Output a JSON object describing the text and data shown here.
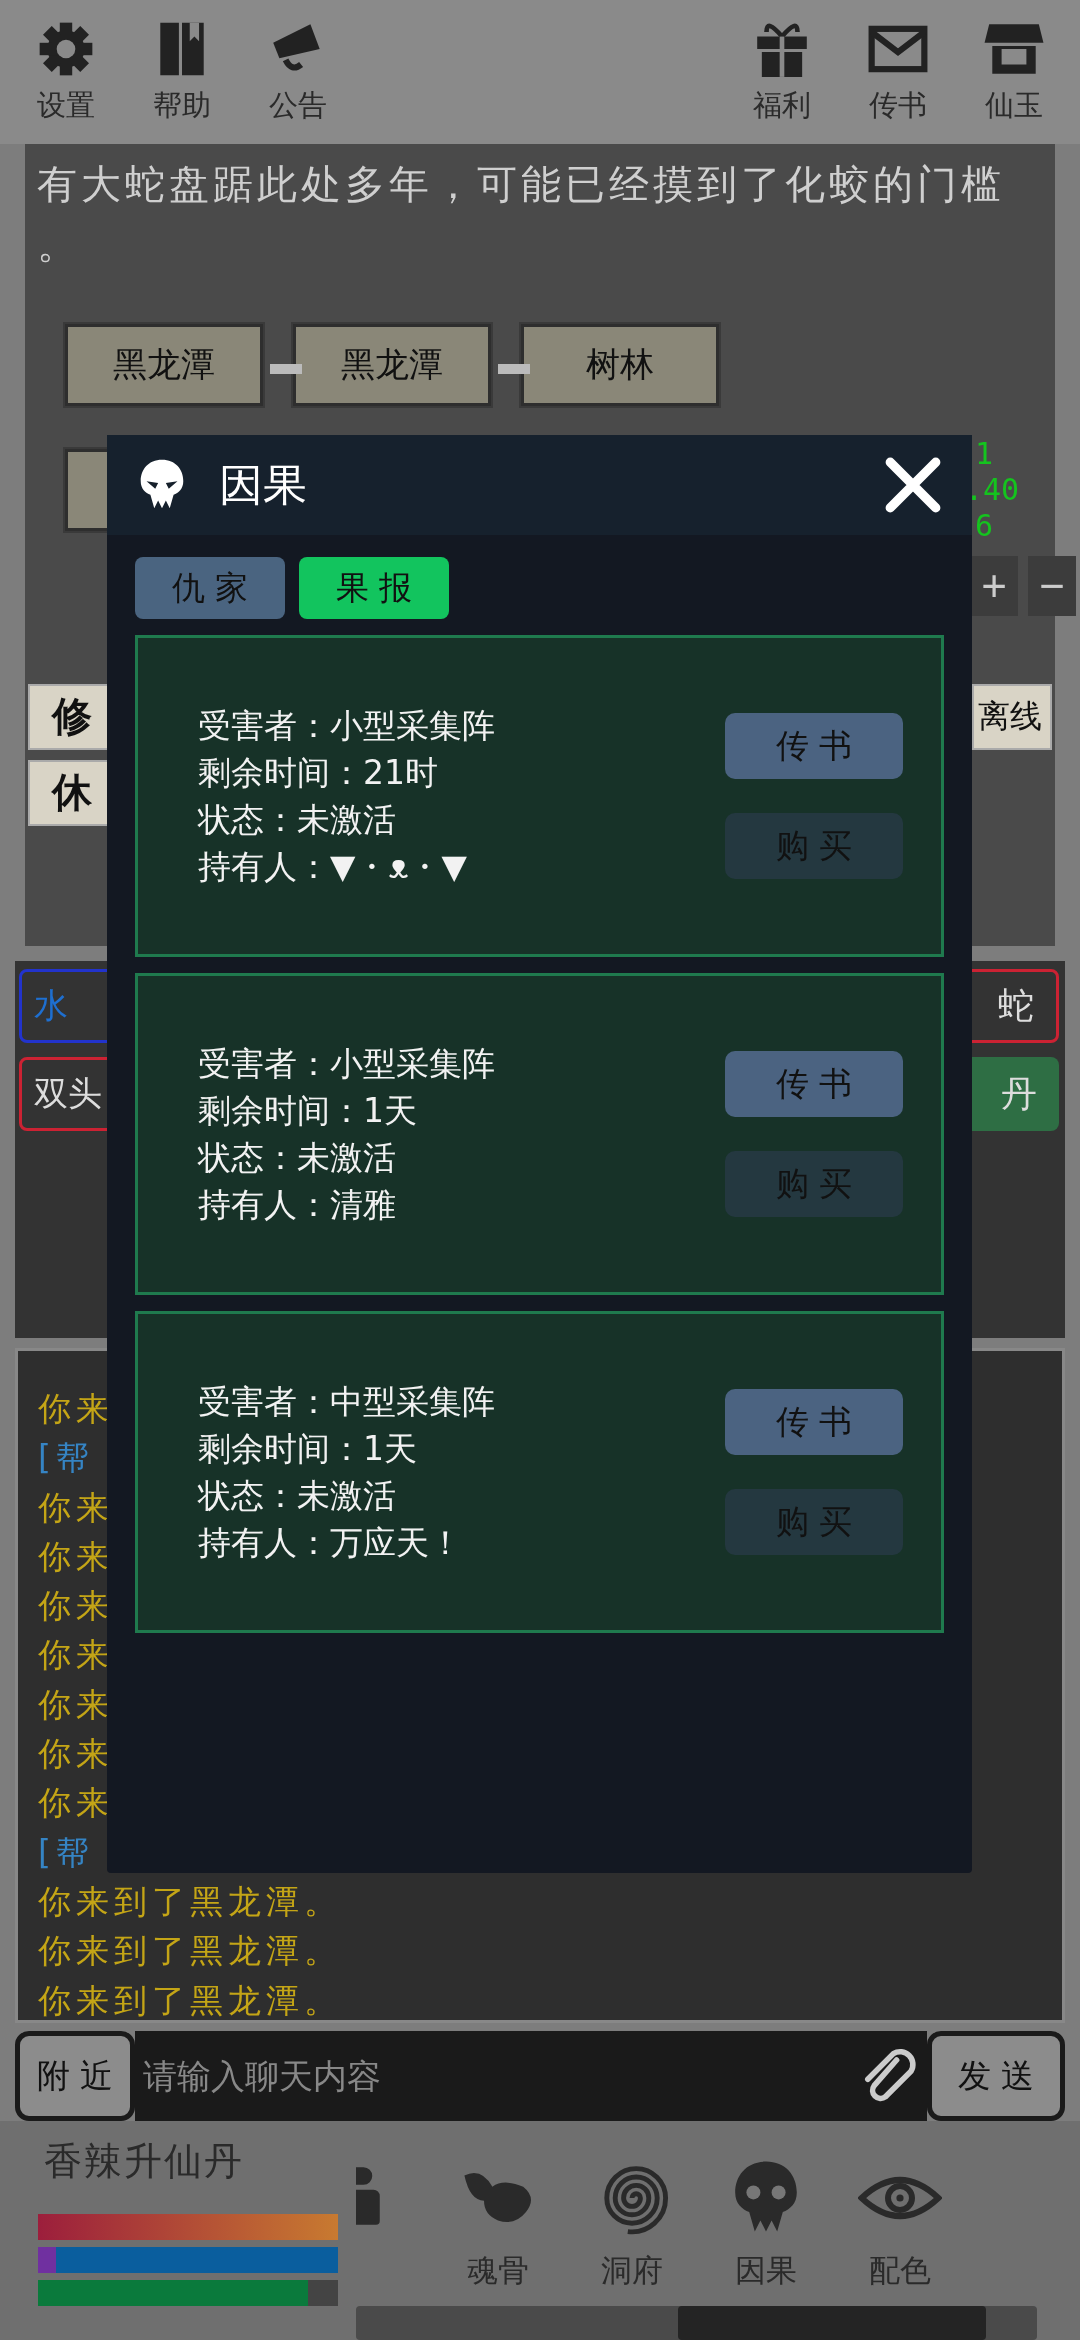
{
  "top_bar": {
    "left": [
      {
        "label": "设置",
        "kind": "gear"
      },
      {
        "label": "帮助",
        "kind": "book"
      },
      {
        "label": "公告",
        "kind": "megaphone"
      }
    ],
    "right": [
      {
        "label": "福利",
        "kind": "gift"
      },
      {
        "label": "传书",
        "kind": "mail"
      },
      {
        "label": "仙玉",
        "kind": "shop"
      }
    ]
  },
  "location": {
    "description": "有大蛇盘踞此处多年，可能已经摸到了化蛟的门槛。",
    "map_nodes": [
      {
        "label": "黑龙潭"
      },
      {
        "label": "黑龙潭"
      },
      {
        "label": "树林"
      }
    ],
    "coordinate_fragments": [
      "1",
      ".40",
      "6"
    ],
    "zoom_controls": [
      "+",
      "−"
    ],
    "actions_left": [
      "修",
      "休"
    ],
    "actions_right": [
      "离线"
    ]
  },
  "monsters": [
    {
      "left": {
        "label": "水",
        "color": "#2233cc"
      },
      "right": {
        "label": "蛇",
        "kind": "outline",
        "color": "#cc2233"
      }
    },
    {
      "left": {
        "label": "双头",
        "color": "#cc2233"
      },
      "right": {
        "label": "丹",
        "kind": "filled",
        "color": "#2e6e44"
      }
    }
  ],
  "log": [
    {
      "text": "你来",
      "kind": "move"
    },
    {
      "text": "[帮",
      "kind": "help"
    },
    {
      "text": "你来",
      "kind": "move"
    },
    {
      "text": "你来",
      "kind": "move"
    },
    {
      "text": "你来",
      "kind": "move"
    },
    {
      "text": "你来",
      "kind": "move"
    },
    {
      "text": "你来",
      "kind": "move"
    },
    {
      "text": "你来",
      "kind": "move"
    },
    {
      "text": "你来",
      "kind": "move"
    },
    {
      "text": "[帮",
      "kind": "help"
    },
    {
      "text": "你来到了黑龙潭。",
      "kind": "move"
    },
    {
      "text": "你来到了黑龙潭。",
      "kind": "move"
    },
    {
      "text": "你来到了黑龙潭。",
      "kind": "move"
    }
  ],
  "dialog": {
    "title": "因果",
    "tabs": [
      {
        "label": "仇 家",
        "selected": false
      },
      {
        "label": "果 报",
        "selected": true
      }
    ],
    "cards": [
      {
        "lines": [
          "受害者：小型采集阵",
          "剩余时间：21时",
          "状态：未激活",
          "持有人：▼・ᴥ・▼"
        ],
        "buttons": [
          {
            "label": "传 书",
            "kind": "primary"
          },
          {
            "label": "购 买",
            "kind": "secondary"
          }
        ]
      },
      {
        "lines": [
          "受害者：小型采集阵",
          "剩余时间：1天",
          "状态：未激活",
          "持有人：清雅"
        ],
        "buttons": [
          {
            "label": "传 书",
            "kind": "primary"
          },
          {
            "label": "购 买",
            "kind": "secondary"
          }
        ]
      },
      {
        "lines": [
          "受害者：中型采集阵",
          "剩余时间：1天",
          "状态：未激活",
          "持有人：万应天！"
        ],
        "buttons": [
          {
            "label": "传 书",
            "kind": "primary"
          },
          {
            "label": "购 买",
            "kind": "secondary"
          }
        ]
      }
    ]
  },
  "chat": {
    "channel": "附 近",
    "placeholder": "请输入聊天内容",
    "send": "发 送"
  },
  "status": {
    "item": "香辣升仙丹",
    "bars": [
      {
        "kind": "health",
        "level": 1
      },
      {
        "kind": "mana",
        "level": 0.06
      },
      {
        "kind": "stamina",
        "level": 0.9
      }
    ]
  },
  "nav": [
    {
      "label": "魂骨",
      "kind": "wing"
    },
    {
      "label": "洞府",
      "kind": "spiral"
    },
    {
      "label": "因果",
      "kind": "skull"
    },
    {
      "label": "配色",
      "kind": "eye"
    }
  ]
}
